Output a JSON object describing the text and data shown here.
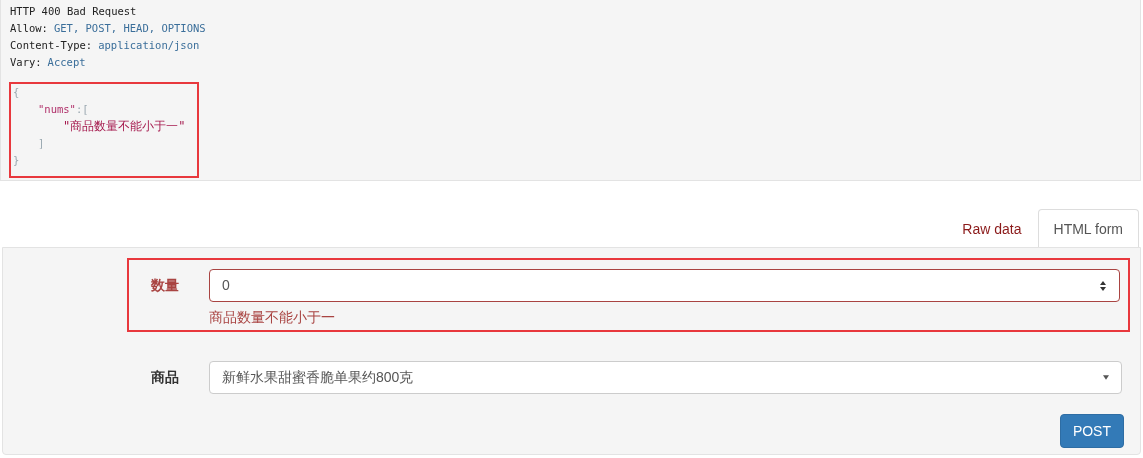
{
  "response": {
    "status_line": "HTTP 400 Bad Request",
    "headers": [
      {
        "name": "Allow:",
        "value": "GET, POST, HEAD, OPTIONS"
      },
      {
        "name": "Content-Type:",
        "value": "application/json"
      },
      {
        "name": "Vary:",
        "value": "Accept"
      }
    ],
    "body": {
      "highlighted": true,
      "open": "{",
      "key": "\"nums\"",
      "separator": ":",
      "array_open": "[",
      "items": [
        "\"商品数量不能小于一\""
      ],
      "array_close": "]",
      "close": "}"
    }
  },
  "tabs": [
    {
      "label": "Raw data",
      "selected": false
    },
    {
      "label": "HTML form",
      "selected": true
    }
  ],
  "form": {
    "fields": [
      {
        "kind": "number",
        "label": "数量",
        "value": "0",
        "error": "商品数量不能小于一",
        "highlighted": true
      },
      {
        "kind": "select",
        "label": "商品",
        "value": "新鲜水果甜蜜香脆单果约800克",
        "highlighted": false
      }
    ],
    "submit": "POST"
  }
}
